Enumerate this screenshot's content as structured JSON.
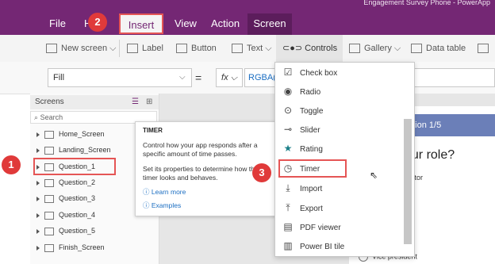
{
  "app_title": "Engagement Survey Phone - PowerApp",
  "menu": {
    "file": "File",
    "home": "H",
    "insert": "Insert",
    "view": "View",
    "action": "Action",
    "screen": "Screen"
  },
  "ribbon": {
    "new_screen": "New screen",
    "label": "Label",
    "button": "Button",
    "text": "Text",
    "controls": "Controls",
    "gallery": "Gallery",
    "data_table": "Data table"
  },
  "formula": {
    "property": "Fill",
    "equals": "=",
    "fx": "fx",
    "value": "RGBA(2"
  },
  "screens_panel": {
    "title": "Screens",
    "search_placeholder": "Search",
    "items": [
      "Home_Screen",
      "Landing_Screen",
      "Question_1",
      "Question_2",
      "Question_3",
      "Question_4",
      "Question_5",
      "Finish_Screen"
    ]
  },
  "tooltip": {
    "title": "TIMER",
    "description": "Control how your app responds after a specific amount of time passes.",
    "properties": "Set its properties to determine how the timer looks and behaves.",
    "learn_more": "Learn more",
    "examples": "Examples"
  },
  "controls_menu": {
    "items": [
      "Check box",
      "Radio",
      "Toggle",
      "Slider",
      "Rating",
      "Timer",
      "Import",
      "Export",
      "PDF viewer",
      "Power BI tile"
    ]
  },
  "preview": {
    "header": "ation 1/5",
    "question": "our role?",
    "option1": "ntributor",
    "option2": "er",
    "option3": "Vice president"
  },
  "steps": [
    "1",
    "2",
    "3"
  ],
  "colors": {
    "brand_purple": "#742774",
    "highlight_red": "#e55555",
    "step_red": "#e03a3a",
    "preview_blue": "#6b7fb8"
  }
}
